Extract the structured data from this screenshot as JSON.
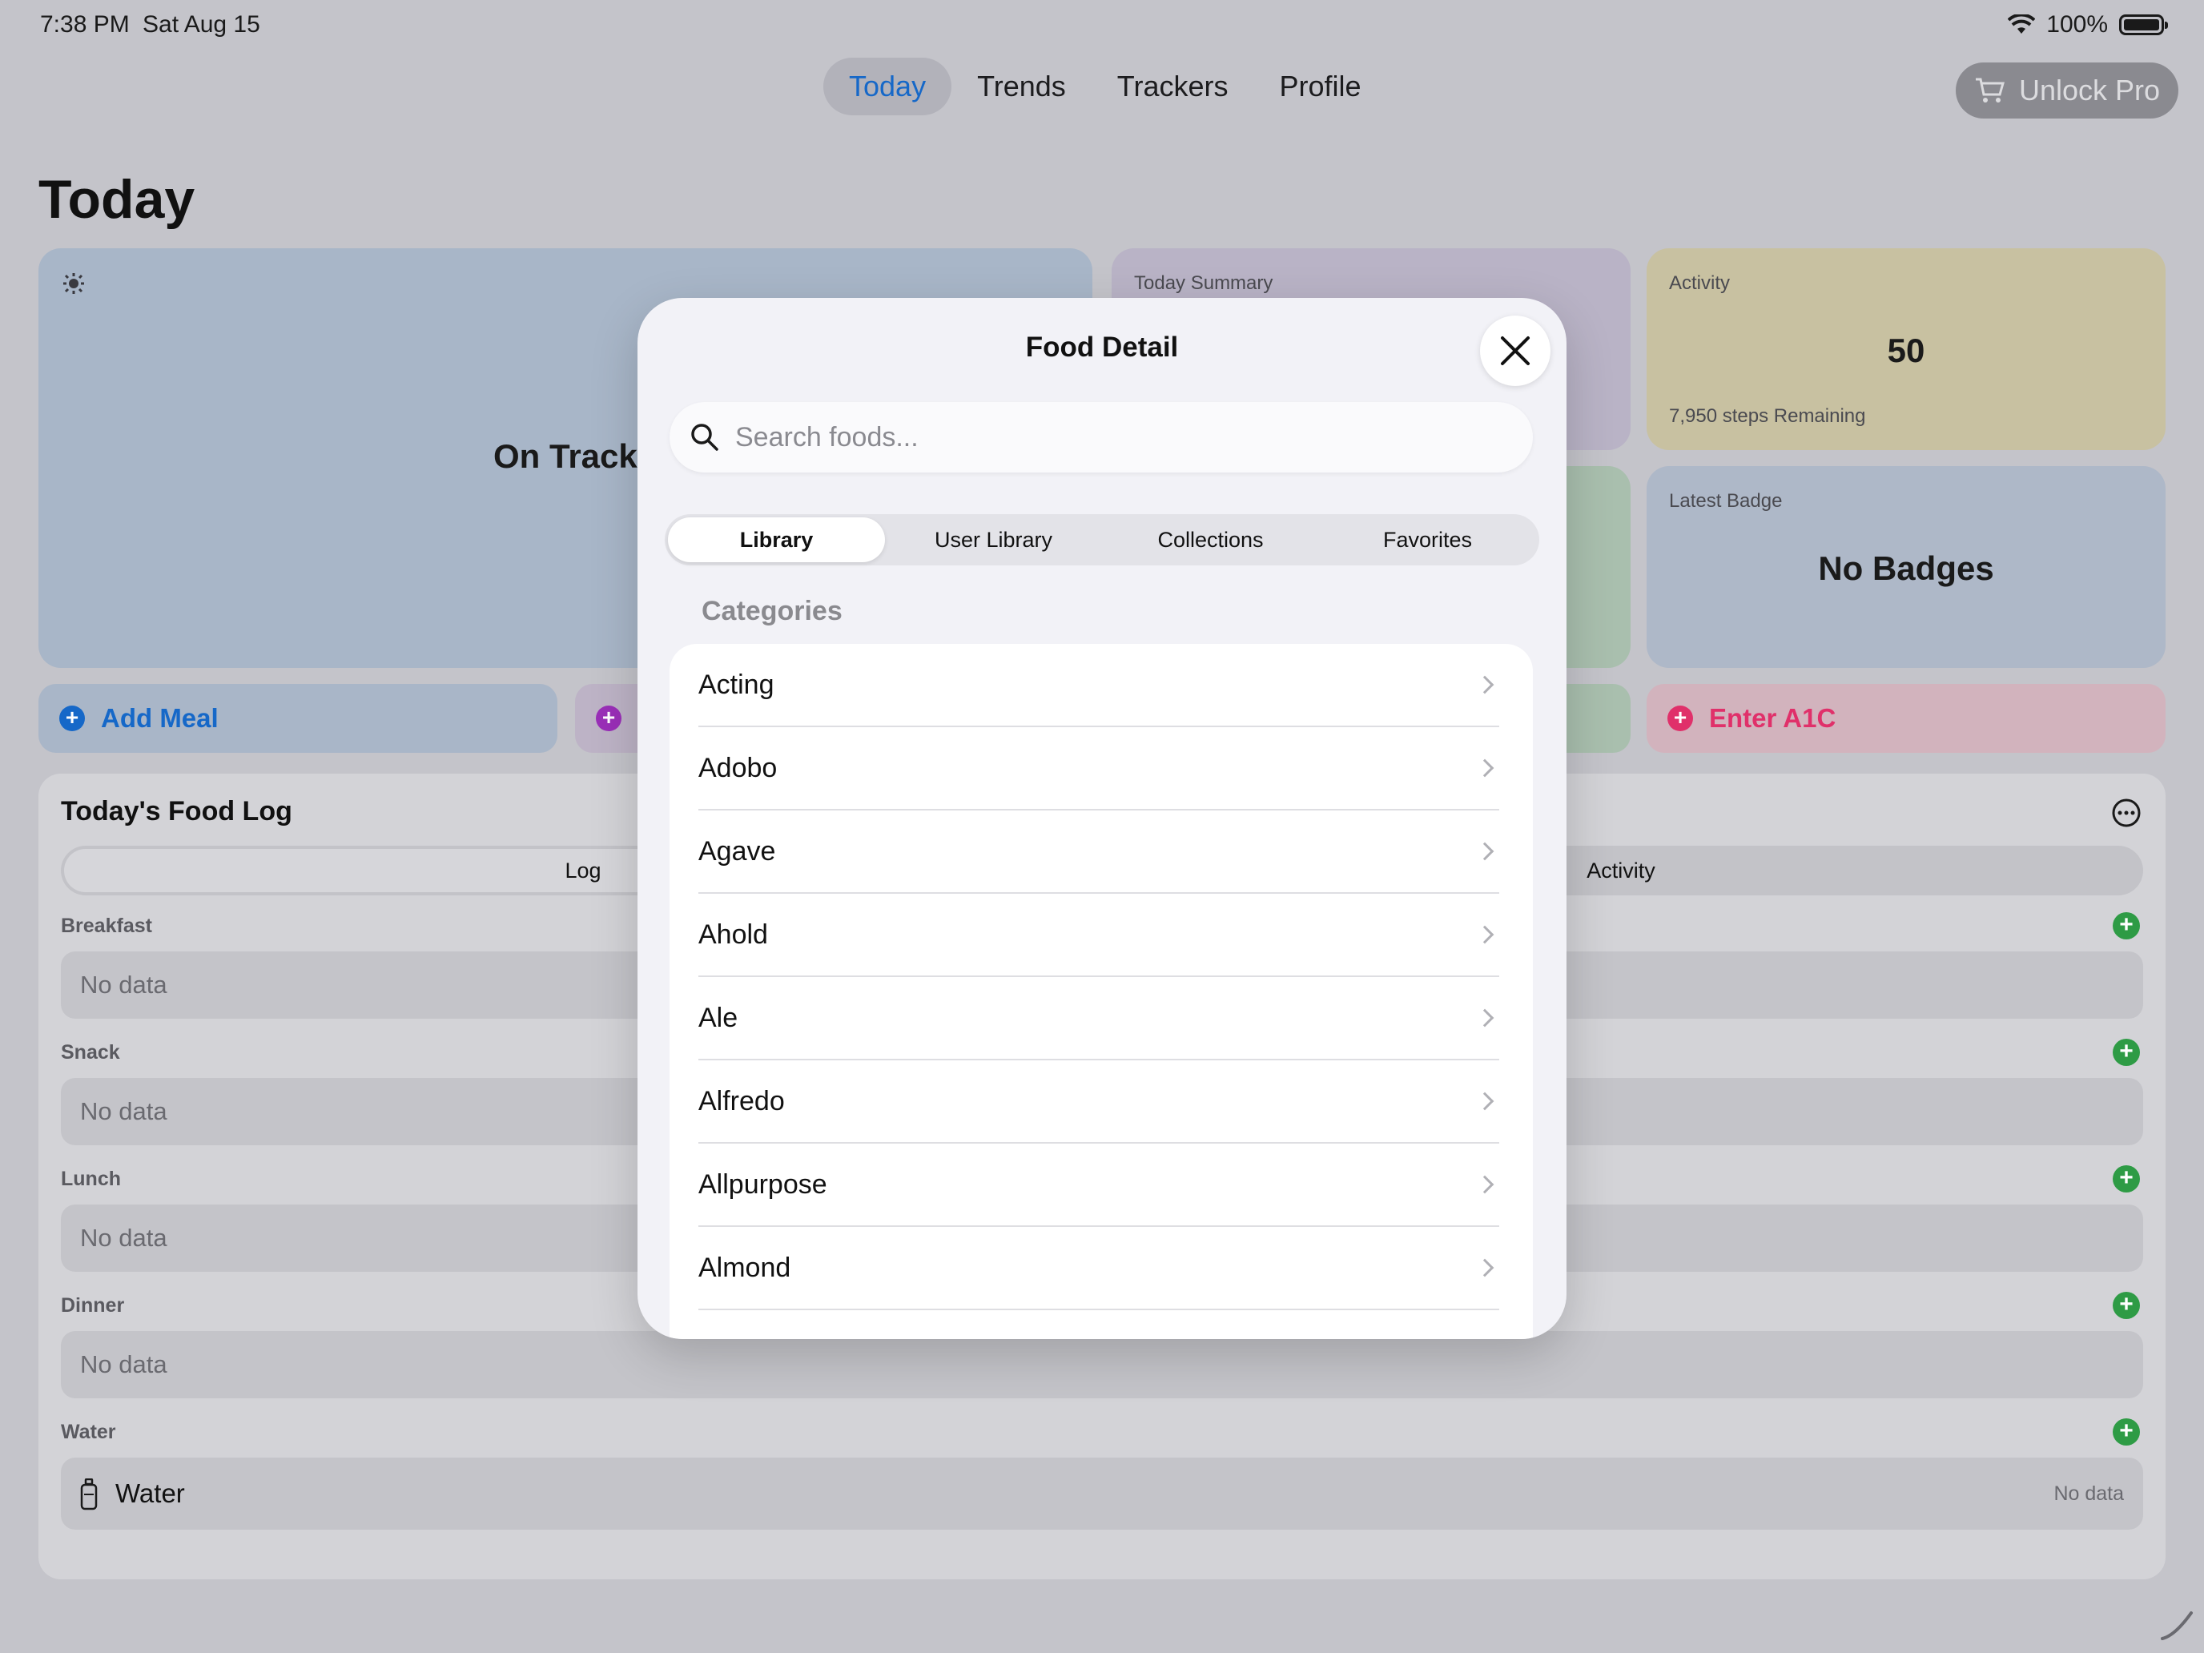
{
  "status": {
    "time": "7:38 PM",
    "date": "Sat Aug 15",
    "battery": "100%"
  },
  "nav": {
    "tabs": [
      "Today",
      "Trends",
      "Trackers",
      "Profile"
    ],
    "active": "Today",
    "unlock_label": "Unlock Pro"
  },
  "page_title": "Today",
  "cards": {
    "on_track": "On Track",
    "summary_label": "Today Summary",
    "activity_label": "Activity",
    "activity_value": "50",
    "activity_sub": "7,950 steps Remaining",
    "badge_label": "Latest Badge",
    "badge_value": "No Badges"
  },
  "actions": {
    "add_meal": "Add Meal",
    "enter_a1c": "Enter A1C"
  },
  "food_log": {
    "title": "Today's Food Log",
    "tab_log": "Log",
    "tab_activity": "Activity",
    "sections": [
      {
        "label": "Breakfast",
        "value": "No data"
      },
      {
        "label": "Snack",
        "value": "No data"
      },
      {
        "label": "Lunch",
        "value": "No data"
      },
      {
        "label": "Dinner",
        "value": "No data"
      }
    ],
    "water_label": "Water",
    "water_item": "Water",
    "water_value": "No data"
  },
  "modal": {
    "title": "Food Detail",
    "search_placeholder": "Search foods...",
    "segments": [
      "Library",
      "User Library",
      "Collections",
      "Favorites"
    ],
    "active_segment": "Library",
    "categories_heading": "Categories",
    "categories": [
      "Acting",
      "Adobo",
      "Agave",
      "Ahold",
      "Ale",
      "Alfredo",
      "Allpurpose",
      "Almond"
    ]
  },
  "colors": {
    "accent": "#1668c8",
    "green": "#2e9b45",
    "pink": "#e0306a"
  }
}
